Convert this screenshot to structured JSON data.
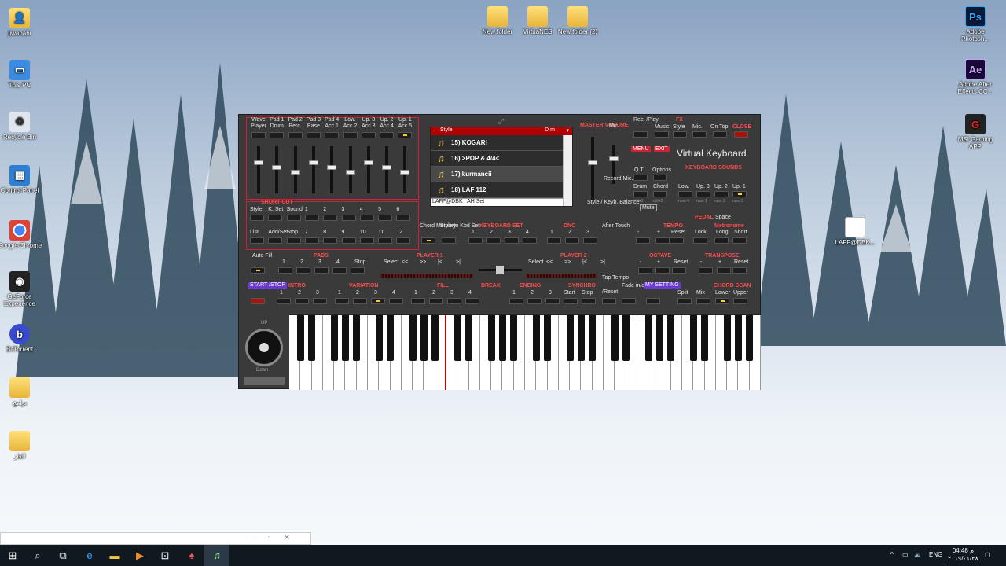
{
  "desktop": {
    "left_icons": [
      {
        "label": "jiwanahi",
        "icon": "user-folder-icon"
      },
      {
        "label": "This PC",
        "icon": "computer-icon"
      },
      {
        "label": "Recycle Bin",
        "icon": "recycle-bin-icon"
      },
      {
        "label": "Control Panel",
        "icon": "control-panel-icon"
      },
      {
        "label": "Google Chrome",
        "icon": "chrome-icon"
      },
      {
        "label": "GeForce Experience",
        "icon": "geforce-icon"
      },
      {
        "label": "BitTorrent",
        "icon": "bittorrent-icon"
      },
      {
        "label": "برامج",
        "icon": "folder-icon"
      },
      {
        "label": "الغاز",
        "icon": "folder-icon"
      }
    ],
    "top_icons": [
      {
        "label": "New folder",
        "icon": "folder-icon"
      },
      {
        "label": "VirtuaNES",
        "icon": "folder-icon"
      },
      {
        "label": "New folder (2)",
        "icon": "folder-icon"
      }
    ],
    "right_icons": [
      {
        "label": "Adobe Photosh...",
        "abbr": "Ps",
        "color": "#0a1a36"
      },
      {
        "label": "Adobe After Effects CC...",
        "abbr": "Ae",
        "color": "#1a0a3a"
      },
      {
        "label": "MSI Gaming APP",
        "abbr": "G",
        "color": "#222"
      }
    ],
    "file_icon": {
      "label": "LAFF@DBK..."
    }
  },
  "app": {
    "title": "Virtual Keyboard",
    "top_labels": [
      "Wave Player",
      "Pad 1 Drum",
      "Pad 2 Perc.",
      "Pad 3 Base",
      "Pad 4 Acc.1",
      "Low. Acc.2",
      "Up. 3 Acc.3",
      "Up. 2 Acc.4",
      "Up. 1 Acc.5"
    ],
    "master_volume": "MASTER VOLUME",
    "mic": "Mic.",
    "rec_play": "Rec. /Play",
    "fx": "FX",
    "fx_items": [
      "Music",
      "Style",
      "Mic."
    ],
    "on_top": "On Top",
    "close": "CLOSE",
    "menu": "MENU",
    "exit": "EXIT",
    "qt": "Q.T.",
    "options": "Options",
    "keyboard_sounds": "KEYBOARD SOUNDS",
    "kb_sounds": [
      "Drum",
      "Chord",
      "Low.",
      "Up. 3",
      "Up. 2",
      "Up. 1"
    ],
    "kb_sub": [
      "ctrl+1",
      "ctrl+2",
      "num 4",
      "num 1",
      "num 2",
      "num 3"
    ],
    "record_mic": "Record Mic.",
    "style_kb_balance": "Style / Keyb. Balance",
    "mute": "Mute",
    "pedal": "PEDAL",
    "space": "Space",
    "style_header": "Style",
    "style_key": "D m",
    "style_rows": [
      "15) KOGARi",
      "16) >POP & 4/4<",
      "17) kurmancii",
      "18) LAF   112"
    ],
    "style_footer": "LAFF@DBK_  AH.Set",
    "short_cut": "SHORT CUT",
    "shortcut_row1": [
      "Style",
      "K. Set",
      "Sound",
      "1",
      "2",
      "3",
      "4",
      "5",
      "6"
    ],
    "shortcut_row2": [
      "List",
      "Add/Set",
      "Stop",
      "7",
      "8",
      "9",
      "10",
      "11",
      "12"
    ],
    "chord_memory": "Chord Memory",
    "style_to_kbd": "Style to Kbd Set",
    "keyboard_set": "KEYBOARD SET",
    "kbset_nums": [
      "1",
      "2",
      "3",
      "4"
    ],
    "dnc": "DNC",
    "dnc_nums": [
      "1",
      "2",
      "3"
    ],
    "after_touch": "After Touch",
    "tempo": "TEMPO",
    "metronome": "Metronome",
    "tempo_items": [
      "-",
      "+",
      "Reset",
      "Lock",
      "Long",
      "Short"
    ],
    "auto_fill": "Auto Fill",
    "pads": "PADS",
    "pads_items": [
      "1",
      "2",
      "3",
      "4",
      "Stop"
    ],
    "player1": "PLAYER 1",
    "player2": "PLAYER 2",
    "player_ctrls": [
      "Select",
      "<<",
      ">>",
      "|<",
      ">|"
    ],
    "octave": "OCTAVE",
    "transpose": "TRANSPOSE",
    "oct_items": [
      "-",
      "+",
      "Reset",
      "-",
      "+",
      "Reset"
    ],
    "tap_tempo": "Tap Tempo",
    "start_stop": "START /STOP",
    "intro": "INTRO",
    "variation": "VARIATION",
    "fill": "FILL",
    "break": "BREAK",
    "ending": "ENDING",
    "synchro": "SYNCHRO",
    "synchro_items": [
      "Start",
      "Stop"
    ],
    "reset": "/Reset",
    "fade": "Fade in/out",
    "my_setting": "MY SETTING",
    "chord_scan": "CHORD SCAN",
    "scan_items": [
      "Split",
      "Mix",
      "Lower",
      "Upper"
    ],
    "up": "UP",
    "down": "Down"
  },
  "taskbar": {
    "lang": "ENG",
    "time": "04:48 م",
    "date": "٢٠١٩/٠١/٢٨"
  }
}
